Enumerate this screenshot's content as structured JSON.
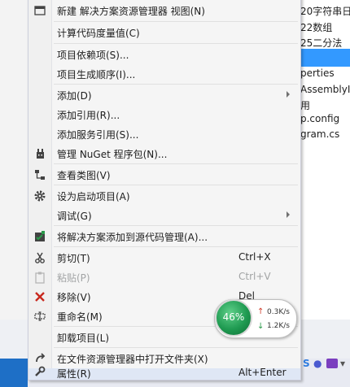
{
  "background": {
    "tree_items": [
      "20字符串日",
      "22数组",
      "25二分法",
      "perties",
      "AssemblyIn",
      "用",
      "p.config",
      "gram.cs"
    ],
    "selection_color": "#3399ff"
  },
  "menu": {
    "items": [
      {
        "label": "新建 解决方案资源管理器 视图(N)",
        "icon": "new-view-icon"
      },
      {
        "label": "计算代码度量值(C)"
      },
      {
        "label": "项目依赖项(S)..."
      },
      {
        "label": "项目生成顺序(I)..."
      },
      {
        "label": "添加(D)",
        "submenu": true
      },
      {
        "label": "添加引用(R)..."
      },
      {
        "label": "添加服务引用(S)..."
      },
      {
        "label": "管理 NuGet 程序包(N)...",
        "icon": "nuget-icon"
      },
      {
        "label": "查看类图(V)",
        "icon": "class-diagram-icon"
      },
      {
        "label": "设为启动项目(A)",
        "icon": "gear-icon"
      },
      {
        "label": "调试(G)",
        "submenu": true
      },
      {
        "label": "将解决方案添加到源代码管理(A)...",
        "icon": "source-control-icon"
      },
      {
        "label": "剪切(T)",
        "shortcut": "Ctrl+X",
        "icon": "scissors-icon"
      },
      {
        "label": "粘贴(P)",
        "shortcut": "Ctrl+V",
        "icon": "paste-icon",
        "disabled": true
      },
      {
        "label": "移除(V)",
        "shortcut": "Del",
        "icon": "remove-icon"
      },
      {
        "label": "重命名(M)",
        "icon": "rename-icon"
      },
      {
        "label": "卸载项目(L)"
      },
      {
        "label": "在文件资源管理器中打开文件夹(X)",
        "icon": "open-folder-icon"
      },
      {
        "label": "属性(R)",
        "shortcut": "Alt+Enter",
        "icon": "wrench-icon"
      }
    ]
  },
  "network_widget": {
    "percent": "46%",
    "upload": "0.3K/s",
    "download": "1.2K/s"
  },
  "tray": {
    "letter": "S"
  }
}
